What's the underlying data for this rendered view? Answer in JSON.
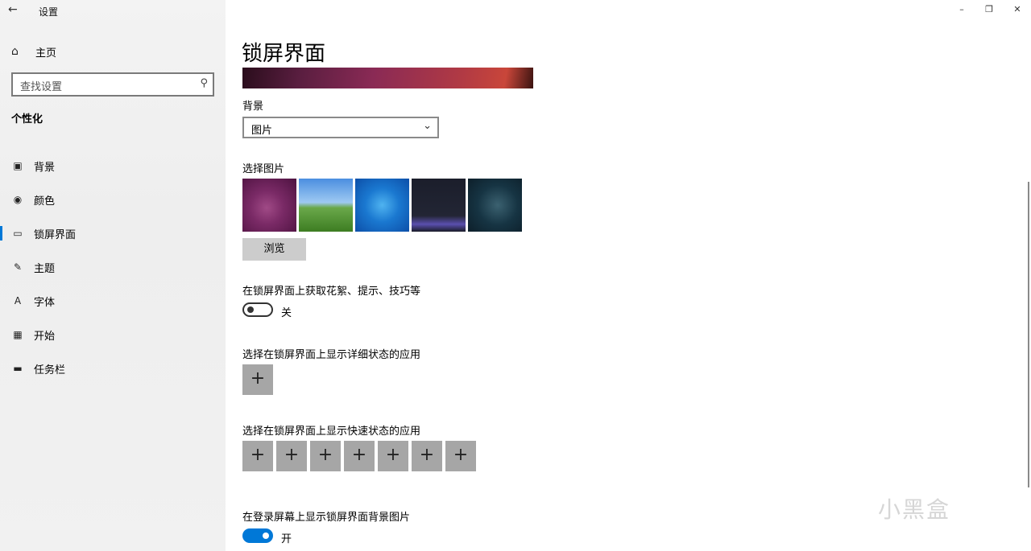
{
  "window": {
    "title": "设置",
    "back_icon": "arrow-left-icon",
    "controls": [
      "minimize-icon",
      "restore-icon",
      "close-icon"
    ]
  },
  "sidebar": {
    "home_label": "主页",
    "search_placeholder": "查找设置",
    "section_title": "个性化",
    "items": [
      {
        "label": "背景",
        "icon": "picture-icon"
      },
      {
        "label": "颜色",
        "icon": "palette-icon"
      },
      {
        "label": "锁屏界面",
        "icon": "lock-screen-icon",
        "active": true
      },
      {
        "label": "主题",
        "icon": "theme-icon"
      },
      {
        "label": "字体",
        "icon": "font-icon"
      },
      {
        "label": "开始",
        "icon": "start-icon"
      },
      {
        "label": "任务栏",
        "icon": "taskbar-icon"
      }
    ]
  },
  "main": {
    "title": "锁屏界面",
    "background_label": "背景",
    "background_value": "图片",
    "choose_picture_label": "选择图片",
    "browse_label": "浏览",
    "fun_facts_label": "在锁屏界面上获取花絮、提示、技巧等",
    "fun_facts_state": "关",
    "detailed_status_label": "选择在锁屏界面上显示详细状态的应用",
    "quick_status_label": "选择在锁屏界面上显示快速状态的应用",
    "quick_status_slots": 7,
    "signin_bg_label": "在登录屏幕上显示锁屏界面背景图片",
    "signin_bg_state": "开"
  },
  "watermark": "小黑盒",
  "colors": {
    "accent": "#0078d7",
    "sidebar_bg": "#f2f2f2",
    "tile_bg": "#a6a6a6"
  }
}
